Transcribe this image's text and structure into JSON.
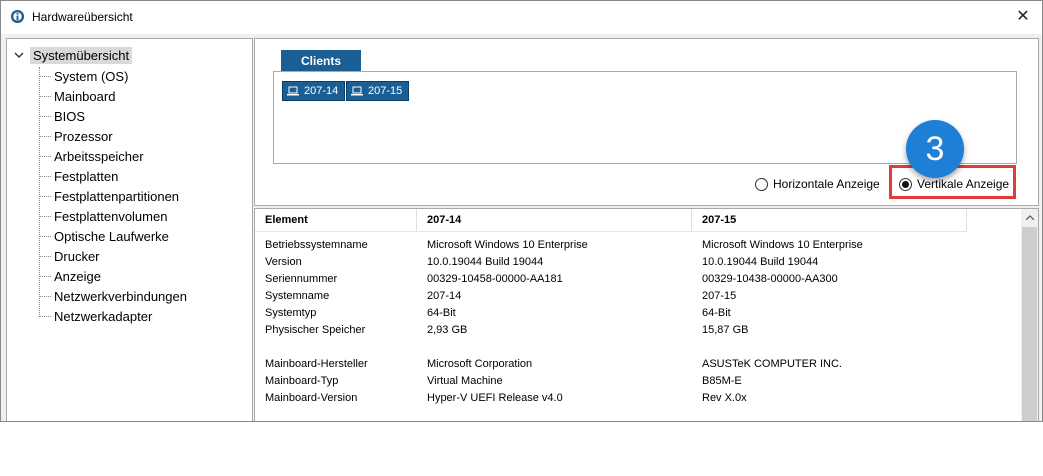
{
  "window": {
    "title": "Hardwareübersicht"
  },
  "tree": {
    "root": "Systemübersicht",
    "items": [
      "System (OS)",
      "Mainboard",
      "BIOS",
      "Prozessor",
      "Arbeitsspeicher",
      "Festplatten",
      "Festplattenpartitionen",
      "Festplattenvolumen",
      "Optische Laufwerke",
      "Drucker",
      "Anzeige",
      "Netzwerkverbindungen",
      "Netzwerkadapter"
    ]
  },
  "clients": {
    "tab_label": "Clients",
    "chips": [
      "207-14",
      "207-15"
    ]
  },
  "view_options": {
    "horizontal": "Horizontale Anzeige",
    "vertical": "Vertikale Anzeige",
    "selected": "vertical"
  },
  "callout": {
    "number": "3",
    "color": "#1e7fd6",
    "box_color": "#e03c3c"
  },
  "table": {
    "headers": [
      "Element",
      "207-14",
      "207-15"
    ],
    "rows": [
      [
        "Betriebssystemname",
        "Microsoft Windows 10 Enterprise",
        "Microsoft Windows 10 Enterprise"
      ],
      [
        "Version",
        "10.0.19044 Build 19044",
        "10.0.19044 Build 19044"
      ],
      [
        "Seriennummer",
        "00329-10458-00000-AA181",
        "00329-10438-00000-AA300"
      ],
      [
        "Systemname",
        "207-14",
        "207-15"
      ],
      [
        "Systemtyp",
        "64-Bit",
        "64-Bit"
      ],
      [
        "Physischer Speicher",
        "2,93 GB",
        "15,87 GB"
      ],
      [
        "",
        "",
        ""
      ],
      [
        "Mainboard-Hersteller",
        "Microsoft Corporation",
        "ASUSTeK COMPUTER INC."
      ],
      [
        "Mainboard-Typ",
        "Virtual Machine",
        "B85M-E"
      ],
      [
        "Mainboard-Version",
        "Hyper-V UEFI Release v4.0",
        "Rev X.0x"
      ]
    ]
  },
  "colors": {
    "accent": "#1a5e94"
  }
}
